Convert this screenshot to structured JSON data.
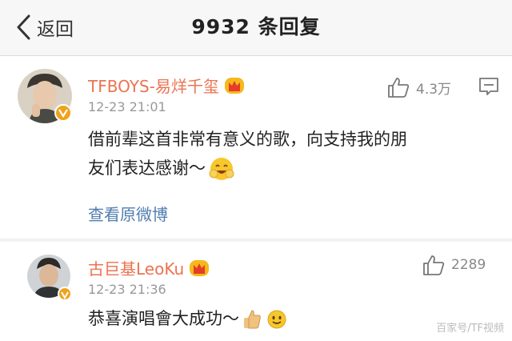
{
  "header": {
    "back_label": "返回",
    "title": "9932 条回复"
  },
  "comment1": {
    "username": "TFBOYS-易烊千玺",
    "time": "12-23 21:01",
    "likes": "4.3万",
    "text_line1": "借前辈这首非常有意义的歌，向支持我的朋",
    "text_line2": "友们表达感谢～",
    "view_original": "查看原微博"
  },
  "comment2": {
    "username": "古巨基LeoKu",
    "time": "12-23 21:36",
    "likes": "2289",
    "text": "恭喜演唱會大成功～"
  },
  "watermark": "百家号/TF视频",
  "colors": {
    "username": "#eb7350",
    "link": "#507daf",
    "badge": "#f0a21a"
  }
}
